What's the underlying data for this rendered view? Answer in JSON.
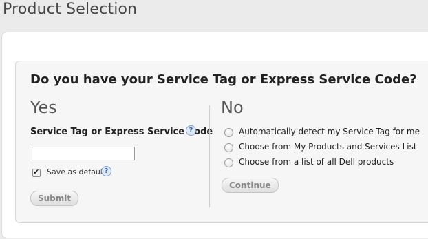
{
  "page": {
    "title": "Product Selection"
  },
  "panel": {
    "question": "Do you have your Service Tag or Express Service Code?",
    "yes": {
      "heading": "Yes",
      "field_label": "Service Tag or Express Service Code",
      "input_value": "",
      "help_glyph": "?",
      "save_default_label": "Save as default",
      "save_default_checked": true,
      "submit_label": "Submit"
    },
    "no": {
      "heading": "No",
      "options": [
        {
          "label": "Automatically detect my Service Tag for me"
        },
        {
          "label": "Choose from My Products and Services List"
        },
        {
          "label": "Choose from a list of all Dell products"
        }
      ],
      "continue_label": "Continue"
    }
  },
  "icons": {
    "help": "help-question-icon",
    "check": "checkmark-icon"
  },
  "colors": {
    "help_blue": "#2d66b0",
    "disabled_text": "#888888"
  }
}
